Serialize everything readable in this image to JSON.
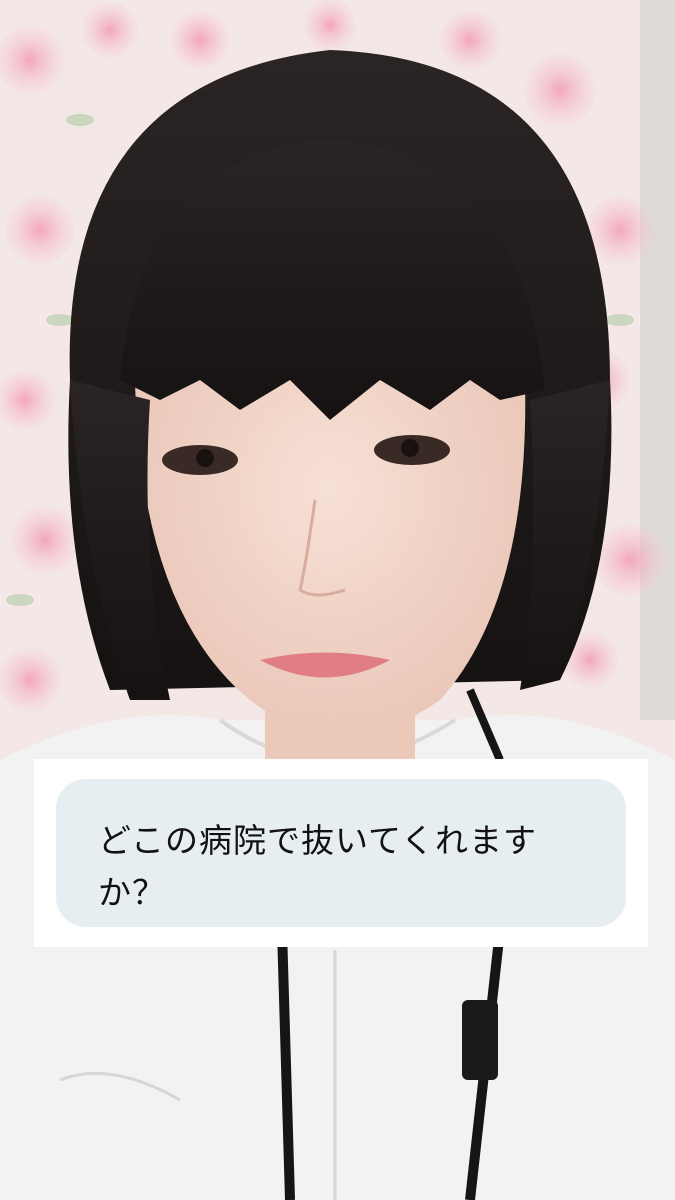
{
  "video": {
    "scene_description_icon": "person-selfie-video-frame"
  },
  "comment": {
    "text": "どこの病院で抜いてくれますか？"
  },
  "colors": {
    "card_bg": "#ffffff",
    "bubble_bg": "#e7eef2",
    "text": "#111111"
  }
}
